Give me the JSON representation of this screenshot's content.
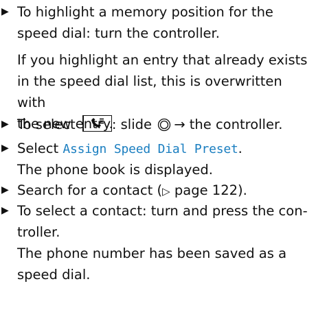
{
  "steps": [
    {
      "line1": "To highlight a memory position for the",
      "line2": "speed dial: turn the controller."
    },
    {
      "pre": "To select",
      "post": ": slide",
      "post2": "the controller."
    },
    {
      "pre": "Select",
      "menu": "Assign Speed Dial Preset",
      "dot": "."
    },
    {
      "text": "Search for a contact (",
      "pointer": "▷",
      "page": "page 122)."
    },
    {
      "line1": "To select a contact: turn and press the con-",
      "line2": "troller."
    }
  ],
  "notes": [
    {
      "line1": "If you highlight an entry that already exists",
      "line2": "in the speed dial list, this is overwritten with",
      "line3": "the new entry."
    },
    {
      "line1": "The phone book is displayed."
    },
    {
      "line1": "The phone number has been saved as a",
      "line2": "speed dial."
    }
  ],
  "icons": {
    "bullet": "▶",
    "arrow": "→",
    "phone_book_icon": "phone-book-icon",
    "controller_icon": "controller-icon"
  }
}
